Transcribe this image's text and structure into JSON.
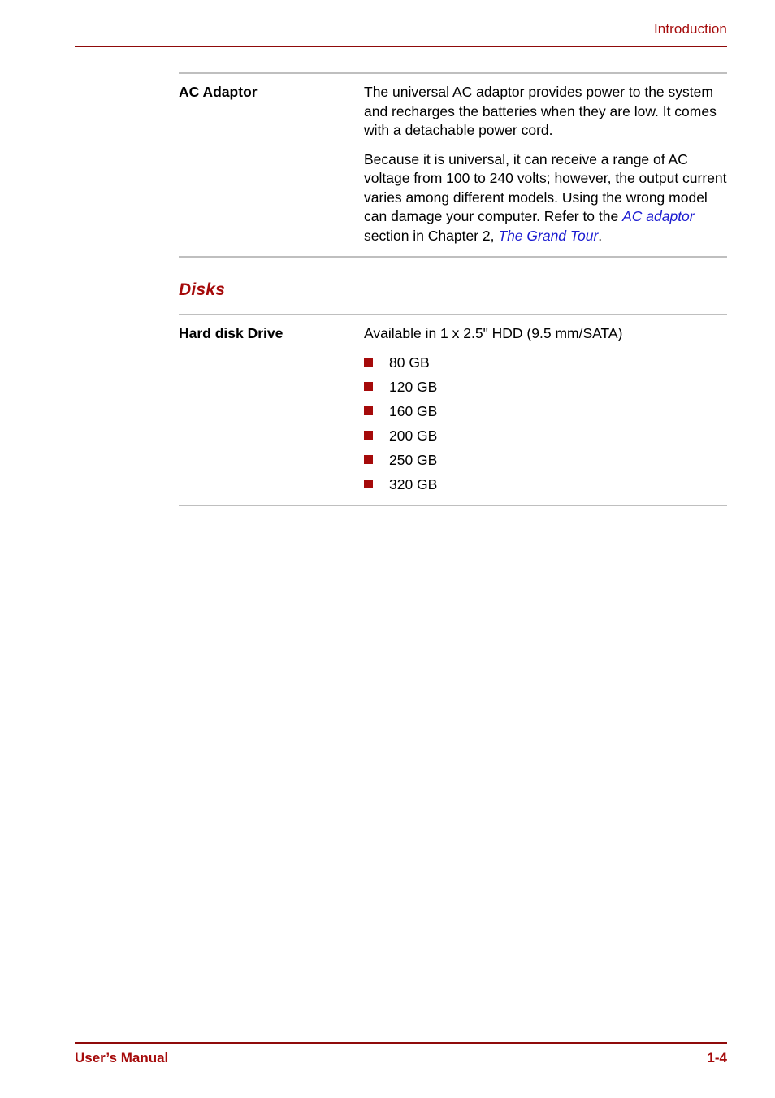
{
  "header": {
    "title": "Introduction"
  },
  "specs": [
    {
      "term": "AC Adaptor",
      "paragraphs": [
        {
          "runs": [
            {
              "text": "The universal AC adaptor provides power to the system and recharges the batteries when they are low. It comes with a detachable power cord.",
              "style": "plain"
            }
          ]
        },
        {
          "runs": [
            {
              "text": "Because it is universal, it can receive a range of AC voltage from 100 to 240 volts; however, the output current varies among different models. Using the wrong model can damage your computer. Refer to the ",
              "style": "plain"
            },
            {
              "text": "AC adaptor",
              "style": "xref"
            },
            {
              "text": " section in Chapter 2, ",
              "style": "plain"
            },
            {
              "text": "The Grand Tour",
              "style": "xref"
            },
            {
              "text": ".",
              "style": "plain"
            }
          ]
        }
      ]
    }
  ],
  "section": {
    "heading": "Disks",
    "row": {
      "term": "Hard disk Drive",
      "intro": "Available in 1 x 2.5\" HDD (9.5 mm/SATA)",
      "bullets": [
        "80 GB",
        "120 GB",
        "160 GB",
        "200 GB",
        "250 GB",
        "320 GB"
      ]
    }
  },
  "footer": {
    "left": "User’s Manual",
    "page": "1-4"
  },
  "colors": {
    "brand_red": "#a50a0a",
    "rule_red": "#8f0a0a",
    "rule_gray": "#bfbfbf",
    "link_blue": "#1a1ad0"
  }
}
